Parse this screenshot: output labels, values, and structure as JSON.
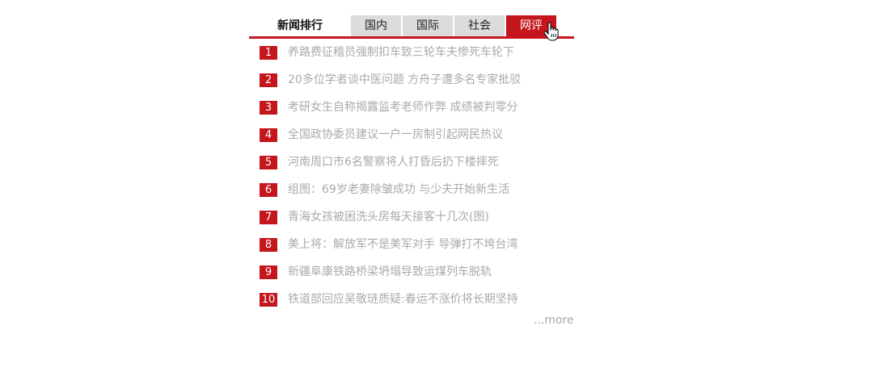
{
  "ranking": {
    "title": "新闻排行",
    "tabs": [
      {
        "label": "国内",
        "active": false
      },
      {
        "label": "国际",
        "active": false
      },
      {
        "label": "社会",
        "active": false
      },
      {
        "label": "网评",
        "active": true
      }
    ],
    "items": [
      {
        "rank": "1",
        "headline": "养路费征稽员强制扣车致三轮车夫惨死车轮下"
      },
      {
        "rank": "2",
        "headline": "20多位学者谈中医问题 方舟子遭多名专家批驳"
      },
      {
        "rank": "3",
        "headline": "考研女生自称揭露监考老师作弊 成绩被判零分"
      },
      {
        "rank": "4",
        "headline": "全国政协委员建议一户一房制引起网民热议"
      },
      {
        "rank": "5",
        "headline": "河南周口市6名警察将人打昏后扔下楼摔死"
      },
      {
        "rank": "6",
        "headline": "组图：69岁老妻除皱成功 与少夫开始新生活"
      },
      {
        "rank": "7",
        "headline": "青海女孩被困洗头房每天接客十几次(图)"
      },
      {
        "rank": "8",
        "headline": "美上将：解放军不是美军对手 导弹打不垮台湾"
      },
      {
        "rank": "9",
        "headline": "新疆阜康铁路桥梁坍塌导致运煤列车脱轨"
      },
      {
        "rank": "10",
        "headline": "铁道部回应吴敬琏质疑:春运不涨价将长期坚持"
      }
    ],
    "more_label": "...more"
  },
  "colors": {
    "accent": "#c4161c",
    "tab_inactive": "#dcdcdc",
    "headline_text": "#aaaaaa"
  },
  "icons": {
    "cursor": "hand-pointer-icon"
  }
}
